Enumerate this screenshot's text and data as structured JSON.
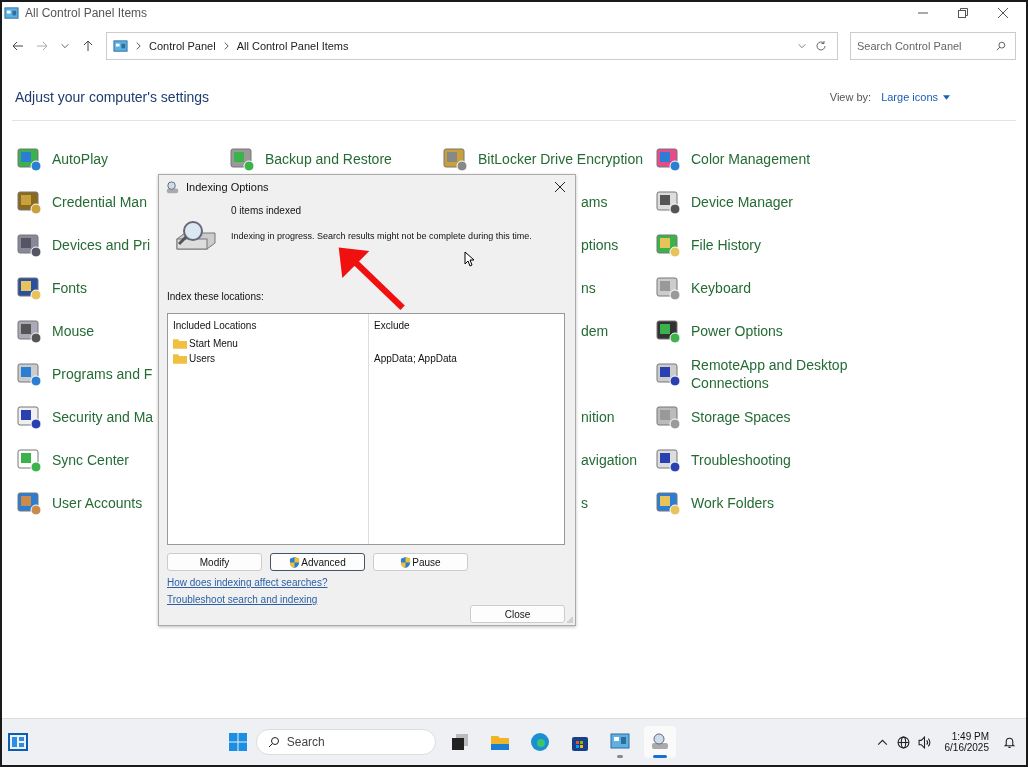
{
  "window": {
    "title": "All Control Panel Items"
  },
  "address": {
    "crumbs": [
      "Control Panel",
      "All Control Panel Items"
    ]
  },
  "search": {
    "placeholder": "Search Control Panel"
  },
  "heading": "Adjust your computer's settings",
  "view_by": {
    "label": "View by:",
    "value": "Large icons"
  },
  "applet_columns": [
    [
      {
        "label": "AutoPlay",
        "kind": "visible"
      },
      {
        "label": "Credential Man",
        "kind": "visible"
      },
      {
        "label": "Devices and Pri",
        "kind": "visible"
      },
      {
        "label": "Fonts",
        "kind": "visible"
      },
      {
        "label": "Mouse",
        "kind": "visible"
      },
      {
        "label": "Programs and F",
        "kind": "visible"
      },
      {
        "label": "Security and Ma",
        "kind": "visible"
      },
      {
        "label": "Sync Center",
        "kind": "visible"
      },
      {
        "label": "User Accounts",
        "kind": "visible"
      }
    ],
    [
      {
        "label": "Backup and Restore",
        "kind": "visible"
      }
    ],
    [
      {
        "label": "BitLocker Drive Encryption",
        "kind": "visible"
      },
      {
        "label": "ams",
        "kind": "covered"
      },
      {
        "label": "ptions",
        "kind": "covered"
      },
      {
        "label": "ns",
        "kind": "covered"
      },
      {
        "label": "dem",
        "kind": "covered"
      },
      {
        "kind": "gap"
      },
      {
        "label": "nition",
        "kind": "covered"
      },
      {
        "label": "avigation",
        "kind": "covered"
      },
      {
        "label": "s",
        "kind": "covered"
      }
    ],
    [
      {
        "label": "Color Management",
        "kind": "visible"
      },
      {
        "label": "Device Manager",
        "kind": "visible"
      },
      {
        "label": "File History",
        "kind": "visible"
      },
      {
        "label": "Keyboard",
        "kind": "visible"
      },
      {
        "label": "Power Options",
        "kind": "visible"
      },
      {
        "label": "RemoteApp and Desktop Connections",
        "kind": "visible"
      },
      {
        "label": "Storage Spaces",
        "kind": "visible"
      },
      {
        "label": "Troubleshooting",
        "kind": "visible"
      },
      {
        "label": "Work Folders",
        "kind": "visible"
      }
    ]
  ],
  "dialog": {
    "title": "Indexing Options",
    "count": "0 items indexed",
    "status": "Indexing in progress. Search results might not be complete during this time.",
    "locations_label": "Index these locations:",
    "columns": [
      "Included Locations",
      "Exclude"
    ],
    "rows": [
      {
        "location": "Start Menu"
      },
      {
        "location": "Users",
        "exclude": "AppData; AppData"
      }
    ],
    "buttons": [
      {
        "label": "Modify",
        "shield": false,
        "focused": false
      },
      {
        "label": "Advanced",
        "shield": true,
        "focused": true
      },
      {
        "label": "Pause",
        "shield": true,
        "focused": false
      }
    ],
    "links": [
      "How does indexing affect searches?",
      "Troubleshoot search and indexing"
    ],
    "close": "Close"
  },
  "taskbar": {
    "search_placeholder": "Search",
    "apps": [
      {
        "running": false,
        "selected": false
      },
      {
        "running": false,
        "selected": false
      },
      {
        "running": false,
        "selected": false
      },
      {
        "running": false,
        "selected": false
      },
      {
        "running": true,
        "selected": false
      },
      {
        "running": true,
        "selected": true
      }
    ],
    "time": "1:49 PM",
    "date": "6/16/2025"
  }
}
